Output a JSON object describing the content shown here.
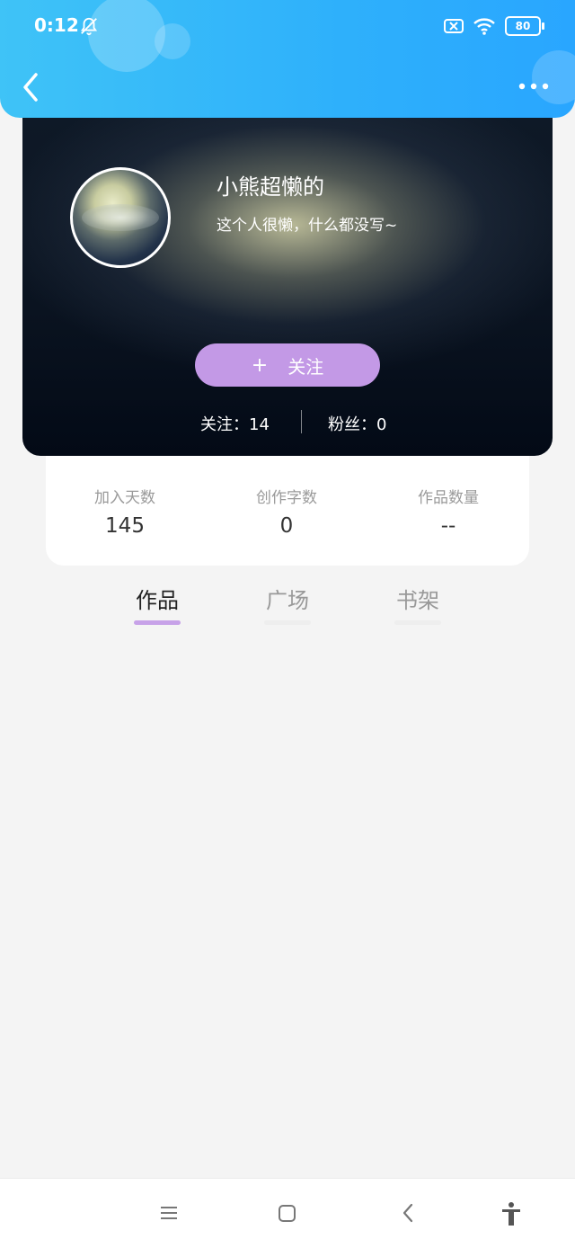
{
  "status_bar": {
    "time": "0:12",
    "battery": "80",
    "icons": [
      "bell-muted-icon",
      "sim-x-icon",
      "wifi-icon",
      "battery-icon"
    ]
  },
  "header": {
    "back_icon": "chevron-left-icon",
    "more_icon": "more-dots-icon",
    "colors": {
      "gradient_start": "#3fc3f7",
      "gradient_end": "#29a6ff"
    }
  },
  "profile": {
    "username": "小熊超懒的",
    "bio": "这个人很懒，什么都没写~",
    "follow_button": {
      "plus": "+",
      "label": "关注",
      "color": "#c399e6"
    },
    "following_text": "关注：14",
    "fans_text": "粉丝：0"
  },
  "stats": [
    {
      "label": "加入天数",
      "value": "145"
    },
    {
      "label": "创作字数",
      "value": "0"
    },
    {
      "label": "作品数量",
      "value": "--"
    }
  ],
  "tabs": [
    {
      "label": "作品",
      "active": true
    },
    {
      "label": "广场",
      "active": false
    },
    {
      "label": "书架",
      "active": false
    }
  ],
  "accent_color": "#c7a2e8",
  "bottom_nav": [
    "menu-icon",
    "home-square-icon",
    "back-chevron-icon",
    "accessibility-icon"
  ]
}
